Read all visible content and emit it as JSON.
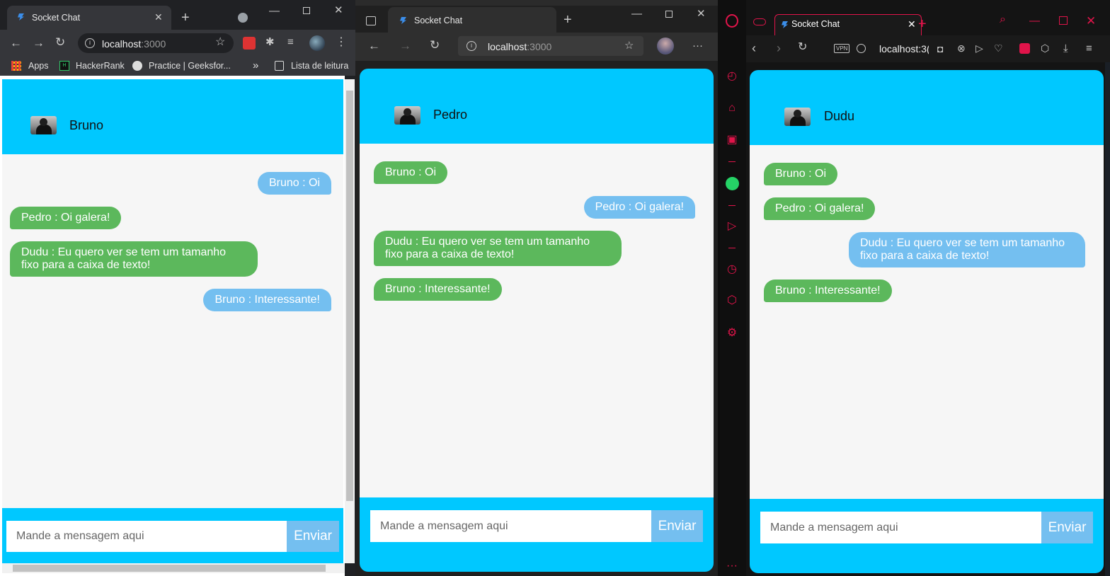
{
  "tab_title": "Socket Chat",
  "url_host": "localhost",
  "url_port": ":3000",
  "url_opera": "localhost:3(",
  "input_placeholder": "Mande a mensagem aqui",
  "send_label": "Enviar",
  "chrome": {
    "bookmarks": [
      "Apps",
      "HackerRank",
      "Practice | Geeksfor...",
      "»",
      "Lista de leitura"
    ],
    "user": "Bruno",
    "messages": [
      {
        "text": "Bruno : Oi",
        "own": true
      },
      {
        "text": "Pedro : Oi galera!",
        "own": false
      },
      {
        "text": "Dudu : Eu quero ver se tem um tamanho fixo para a caixa de texto!",
        "own": false
      },
      {
        "text": "Bruno : Interessante!",
        "own": true
      }
    ]
  },
  "edge": {
    "user": "Pedro",
    "messages": [
      {
        "text": "Bruno : Oi",
        "own": false
      },
      {
        "text": "Pedro : Oi galera!",
        "own": true
      },
      {
        "text": "Dudu : Eu quero ver se tem um tamanho fixo para a caixa de texto!",
        "own": false
      },
      {
        "text": "Bruno : Interessante!",
        "own": false
      }
    ]
  },
  "opera": {
    "vpn_badge": "VPN",
    "user": "Dudu",
    "messages": [
      {
        "text": "Bruno : Oi",
        "own": false
      },
      {
        "text": "Pedro : Oi galera!",
        "own": false
      },
      {
        "text": "Dudu : Eu quero ver se tem um tamanho fixo para a caixa de texto!",
        "own": true
      },
      {
        "text": "Bruno : Interessante!",
        "own": false
      }
    ]
  },
  "colors": {
    "header": "#00c8ff",
    "own_bubble": "#74bff0",
    "other_bubble": "#5cb85c",
    "opera_accent": "#e0144a"
  }
}
